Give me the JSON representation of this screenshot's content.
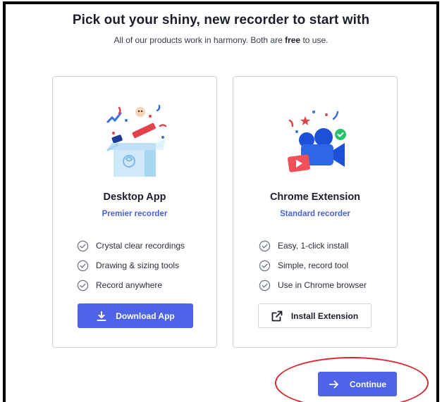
{
  "header": {
    "title": "Pick out your shiny, new recorder to start with",
    "subtitle_before": "All of our products work in harmony. Both are ",
    "subtitle_bold": "free",
    "subtitle_after": " to use."
  },
  "cards": [
    {
      "title": "Desktop App",
      "subtitle": "Premier recorder",
      "features": [
        "Crystal clear recordings",
        "Drawing & sizing tools",
        "Record anywhere"
      ],
      "button_label": "Download App",
      "button_icon": "download-icon",
      "illustration": "gift-box-illustration"
    },
    {
      "title": "Chrome Extension",
      "subtitle": "Standard recorder",
      "features": [
        "Easy, 1-click install",
        "Simple, record tool",
        "Use in Chrome browser"
      ],
      "button_label": "Install Extension",
      "button_icon": "external-link-icon",
      "illustration": "video-camera-illustration"
    }
  ],
  "footer": {
    "continue_label": "Continue",
    "continue_icon": "arrow-right-icon"
  },
  "colors": {
    "accent": "#4d63e8",
    "accent_text": "#4a62d8",
    "highlight": "#d8242c",
    "card_border": "#d3d6dc"
  }
}
